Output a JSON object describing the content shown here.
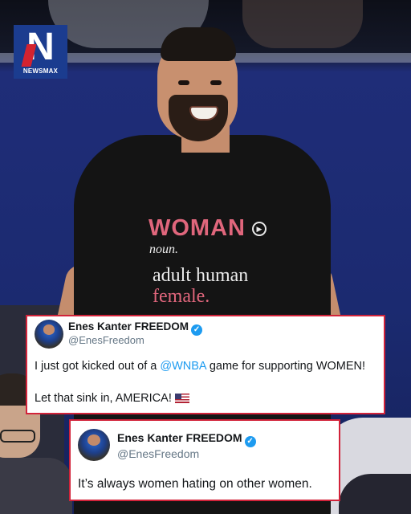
{
  "logo": {
    "letter": "N",
    "brand": "NEWSMAX",
    "colors": {
      "background": "#1b3c8f",
      "accent": "#d32330"
    }
  },
  "shirt": {
    "word": "WOMAN",
    "pos": "noun.",
    "definition_line1": "adult human",
    "definition_line2": "female."
  },
  "tweets": [
    {
      "name": "Enes Kanter FREEDOM",
      "handle": "@EnesFreedom",
      "verified": true,
      "text_before_mention": "I just got kicked out of a ",
      "mention": "@WNBA",
      "text_after_mention": " game for supporting WOMEN!",
      "line2": "Let that sink in, AMERICA!",
      "emoji": "us-flag-icon"
    },
    {
      "name": "Enes Kanter FREEDOM",
      "handle": "@EnesFreedom",
      "verified": true,
      "text": "It’s always women hating on other women."
    }
  ],
  "colors": {
    "card_border": "#d2233a",
    "mention": "#1d9bf0",
    "verified_badge": "#1d9bf0"
  }
}
